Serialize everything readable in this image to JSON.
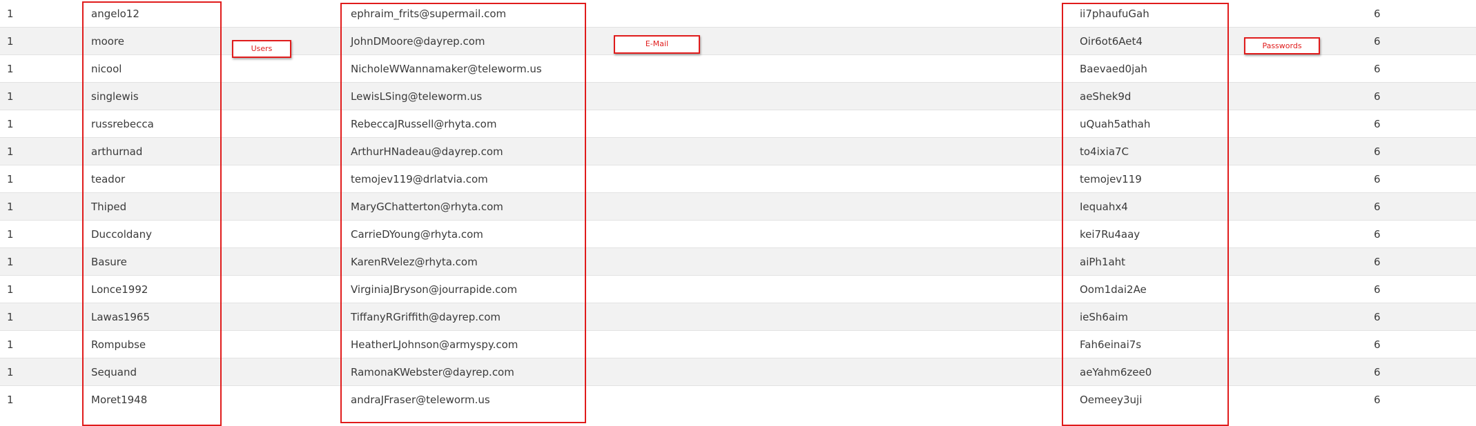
{
  "annotations": {
    "users": "Users",
    "email": "E-Mail",
    "passwords": "Passwords"
  },
  "colors": {
    "annotation": "#e01b1b",
    "row_alt": "#f2f2f2",
    "text": "#3a3a3a"
  },
  "rows": [
    {
      "id": "1",
      "user": "angelo12",
      "email": "ephraim_frits@supermail.com",
      "password": "ii7phaufuGah",
      "num": "6"
    },
    {
      "id": "1",
      "user": "moore",
      "email": "JohnDMoore@dayrep.com",
      "password": "Oir6ot6Aet4",
      "num": "6"
    },
    {
      "id": "1",
      "user": "nicool",
      "email": "NicholeWWannamaker@teleworm.us",
      "password": "Baevaed0jah",
      "num": "6"
    },
    {
      "id": "1",
      "user": "singlewis",
      "email": "LewisLSing@teleworm.us",
      "password": "aeShek9d",
      "num": "6"
    },
    {
      "id": "1",
      "user": "russrebecca",
      "email": "RebeccaJRussell@rhyta.com",
      "password": "uQuah5athah",
      "num": "6"
    },
    {
      "id": "1",
      "user": "arthurnad",
      "email": "ArthurHNadeau@dayrep.com",
      "password": "to4ixia7C",
      "num": "6"
    },
    {
      "id": "1",
      "user": "teador",
      "email": "temojev119@drlatvia.com",
      "password": "temojev119",
      "num": "6"
    },
    {
      "id": "1",
      "user": "Thiped",
      "email": "MaryGChatterton@rhyta.com",
      "password": "Iequahx4",
      "num": "6"
    },
    {
      "id": "1",
      "user": "Duccoldany",
      "email": "CarrieDYoung@rhyta.com",
      "password": "kei7Ru4aay",
      "num": "6"
    },
    {
      "id": "1",
      "user": "Basure",
      "email": "KarenRVelez@rhyta.com",
      "password": "aiPh1aht",
      "num": "6"
    },
    {
      "id": "1",
      "user": "Lonce1992",
      "email": "VirginiaJBryson@jourrapide.com",
      "password": "Oom1dai2Ae",
      "num": "6"
    },
    {
      "id": "1",
      "user": "Lawas1965",
      "email": "TiffanyRGriffith@dayrep.com",
      "password": "ieSh6aim",
      "num": "6"
    },
    {
      "id": "1",
      "user": "Rompubse",
      "email": "HeatherLJohnson@armyspy.com",
      "password": "Fah6einai7s",
      "num": "6"
    },
    {
      "id": "1",
      "user": "Sequand",
      "email": "RamonaKWebster@dayrep.com",
      "password": "aeYahm6zee0",
      "num": "6"
    },
    {
      "id": "1",
      "user": "Moret1948",
      "email": "andraJFraser@teleworm.us",
      "password": "Oemeey3uji",
      "num": "6"
    }
  ]
}
